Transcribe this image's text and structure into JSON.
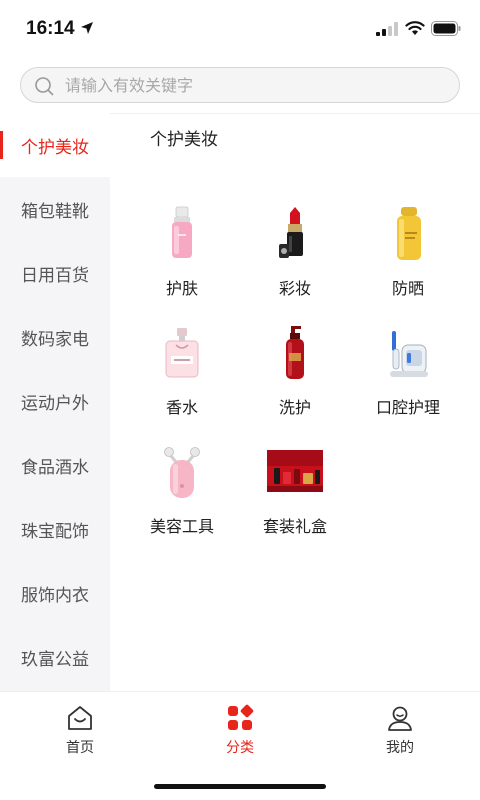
{
  "status_bar": {
    "time": "16:14"
  },
  "search": {
    "placeholder": "请输入有效关键字"
  },
  "sidebar": {
    "items": [
      {
        "label": "个护美妆",
        "active": true
      },
      {
        "label": "箱包鞋靴",
        "active": false
      },
      {
        "label": "日用百货",
        "active": false
      },
      {
        "label": "数码家电",
        "active": false
      },
      {
        "label": "运动户外",
        "active": false
      },
      {
        "label": "食品酒水",
        "active": false
      },
      {
        "label": "珠宝配饰",
        "active": false
      },
      {
        "label": "服饰内衣",
        "active": false
      },
      {
        "label": "玖富公益",
        "active": false
      }
    ]
  },
  "content": {
    "title": "个护美妆",
    "products": [
      {
        "label": "护肤",
        "icon": "pink-toner-bottle-icon"
      },
      {
        "label": "彩妆",
        "icon": "lipstick-icon"
      },
      {
        "label": "防晒",
        "icon": "gold-sunscreen-bottle-icon"
      },
      {
        "label": "香水",
        "icon": "perfume-bottle-icon"
      },
      {
        "label": "洗护",
        "icon": "red-shampoo-bottle-icon"
      },
      {
        "label": "口腔护理",
        "icon": "electric-toothbrush-icon"
      },
      {
        "label": "美容工具",
        "icon": "beauty-device-icon"
      },
      {
        "label": "套装礼盒",
        "icon": "gift-box-set-icon"
      }
    ]
  },
  "tab_bar": {
    "tabs": [
      {
        "label": "首页",
        "icon": "home-icon",
        "active": false
      },
      {
        "label": "分类",
        "icon": "category-grid-icon",
        "active": true
      },
      {
        "label": "我的",
        "icon": "user-icon",
        "active": false
      }
    ]
  },
  "colors": {
    "accent": "#e8251b",
    "sidebar_bg": "#f5f5f7",
    "text": "#222222"
  }
}
